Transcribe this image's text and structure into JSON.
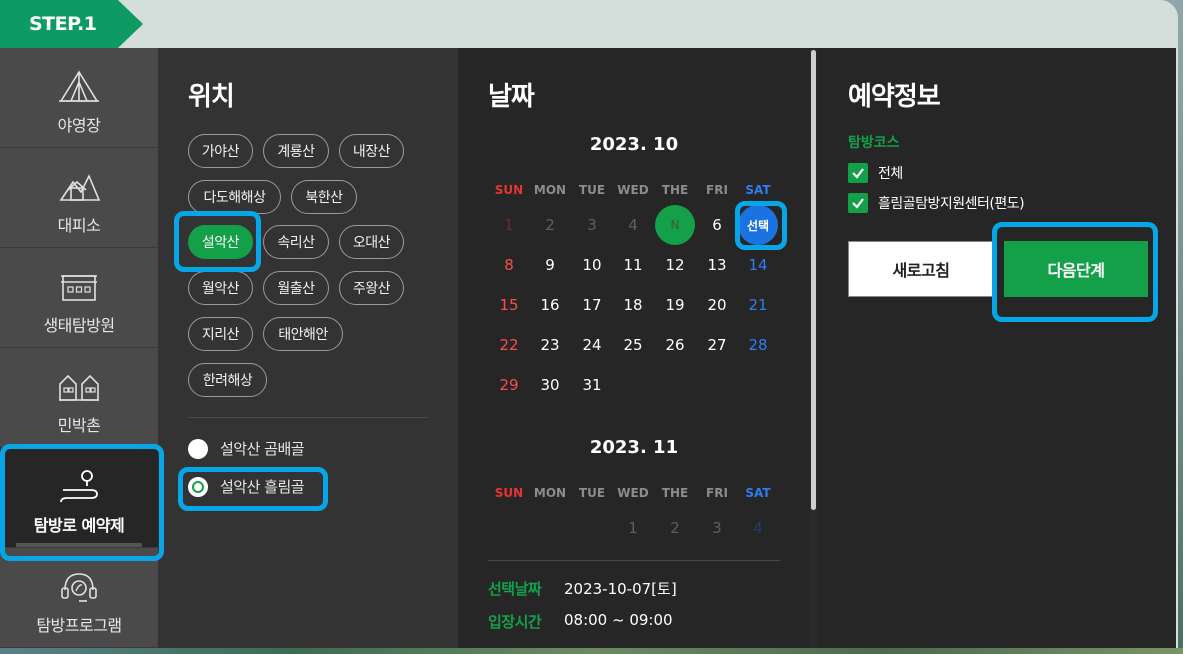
{
  "step": {
    "label": "STEP.1"
  },
  "sidebar": {
    "items": [
      {
        "label": "야영장",
        "icon": "tent-icon"
      },
      {
        "label": "대피소",
        "icon": "shelter-icon"
      },
      {
        "label": "생태탐방원",
        "icon": "building-icon"
      },
      {
        "label": "민박촌",
        "icon": "houses-icon"
      },
      {
        "label": "탐방로 예약제",
        "icon": "trail-pin-icon",
        "active": true
      },
      {
        "label": "탐방프로그램",
        "icon": "headset-leaf-icon"
      }
    ]
  },
  "location": {
    "title": "위치",
    "mountains": [
      "가야산",
      "계룡산",
      "내장산",
      "다도해해상",
      "북한산",
      "설악산",
      "속리산",
      "오대산",
      "월악산",
      "월출산",
      "주왕산",
      "지리산",
      "태안해안",
      "한려해상"
    ],
    "selected_mountain": "설악산",
    "courses": [
      {
        "label": "설악산 곰배골",
        "selected": false
      },
      {
        "label": "설악산 흘림골",
        "selected": true
      }
    ]
  },
  "date": {
    "title": "날짜",
    "weekdays": [
      "SUN",
      "MON",
      "TUE",
      "WED",
      "THE",
      "FRI",
      "SAT"
    ],
    "month1": {
      "title": "2023. 10",
      "today_mark": "N",
      "selected_mark": "선택"
    },
    "month2": {
      "title": "2023. 11"
    },
    "selected_date_label": "선택날짜",
    "selected_date_value": "2023-10-07[토]",
    "entry_time_label": "입장시간",
    "entry_time_value": "08:00 ~ 09:00"
  },
  "reservation": {
    "title": "예약정보",
    "course_label": "탐방코스",
    "checks": [
      "전체",
      "흘림골탐방지원센터(편도)"
    ],
    "reset_button": "새로고침",
    "next_button": "다음단계"
  },
  "colors": {
    "accent_green": "#13a049",
    "highlight_blue": "#08a6e6",
    "sunday_red": "#ff4b4b",
    "saturday_blue": "#2f7df0"
  }
}
